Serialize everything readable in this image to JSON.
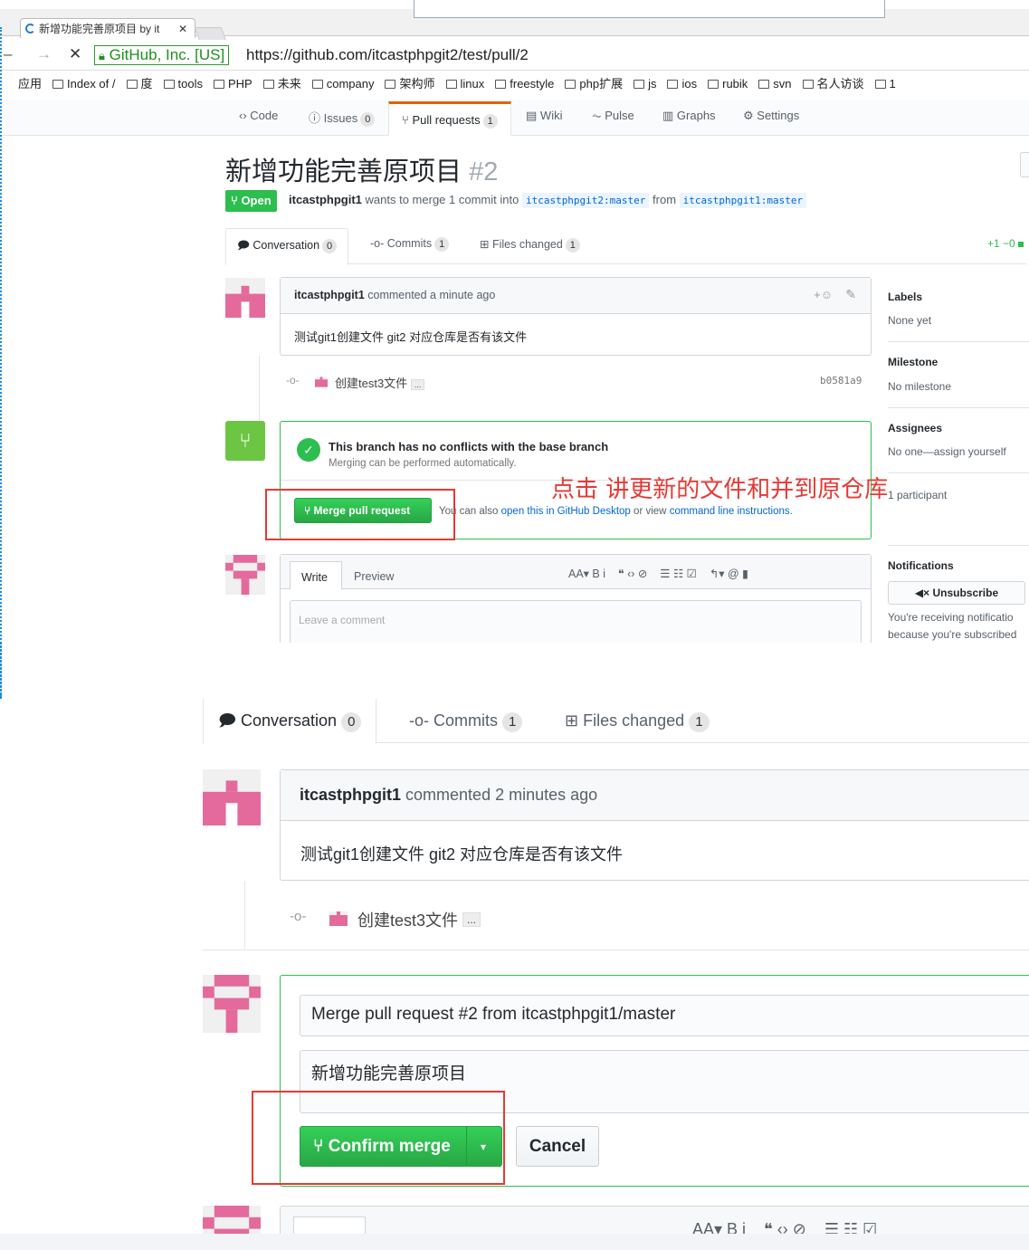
{
  "browser": {
    "tab_title": "新增功能完善原项目 by it",
    "secure_label": "GitHub, Inc. [US]",
    "url": "https://github.com/itcastphpgit2/test/pull/2",
    "bookmarks": [
      "应用",
      "Index of /",
      "度",
      "tools",
      "PHP",
      "未来",
      "company",
      "架构师",
      "linux",
      "freestyle",
      "php扩展",
      "js",
      "ios",
      "rubik",
      "svn",
      "名人访谈",
      "1"
    ]
  },
  "repo_nav": {
    "code": "Code",
    "issues": "Issues",
    "issues_count": "0",
    "pulls": "Pull requests",
    "pulls_count": "1",
    "wiki": "Wiki",
    "pulse": "Pulse",
    "graphs": "Graphs",
    "settings": "Settings"
  },
  "pr": {
    "title": "新增功能完善原项目",
    "number": "#2",
    "state": "Open",
    "author": "itcastphpgit1",
    "merge_text": "wants to merge 1 commit into",
    "base": "itcastphpgit2:master",
    "from_text": "from",
    "head": "itcastphpgit1:master",
    "diffstat": "+1 −0"
  },
  "pr_tabs": {
    "conversation": "Conversation",
    "conversation_count": "0",
    "commits": "Commits",
    "commits_count": "1",
    "files": "Files changed",
    "files_count": "1"
  },
  "top": {
    "comment_author": "itcastphpgit1",
    "comment_time": "commented a minute ago",
    "comment_body": "测试git1创建文件 git2 对应仓库是否有该文件",
    "commit_msg": "创建test3文件",
    "commit_ellipsis": "...",
    "commit_sha": "b0581a9",
    "merge_status_title": "This branch has no conflicts with the base branch",
    "merge_status_sub": "Merging can be performed automatically.",
    "merge_button": "Merge pull request",
    "merge_hint_1": "You can also",
    "merge_hint_link1": "open this in GitHub Desktop",
    "merge_hint_2": "or view",
    "merge_hint_link2": "command line instructions.",
    "annotation": "点击   讲更新的文件和并到原仓库",
    "write_tab": "Write",
    "preview_tab": "Preview",
    "comment_placeholder": "Leave a comment",
    "toolbar": "AA▾ B i    ❝ ‹› ⊘    ☰ ☷ ☑    ↰▾ @ ▮"
  },
  "sidebar": {
    "labels_h": "Labels",
    "labels_v": "None yet",
    "milestone_h": "Milestone",
    "milestone_v": "No milestone",
    "assignees_h": "Assignees",
    "assignees_v": "No one—assign yourself",
    "participants": "1 participant",
    "notifications_h": "Notifications",
    "unsubscribe": "Unsubscribe",
    "notif_text_1": "You're receiving notificatio",
    "notif_text_2": "because you're subscribed"
  },
  "bottom": {
    "comment_author": "itcastphpgit1",
    "comment_time": "commented 2 minutes ago",
    "comment_body": "测试git1创建文件 git2 对应仓库是否有该文件",
    "commit_msg": "创建test3文件",
    "commit_ellipsis": "...",
    "merge_title_value": "Merge pull request #2 from itcastphpgit1/master",
    "merge_body_value": "新增功能完善原项目",
    "confirm_button": "Confirm merge",
    "cancel_button": "Cancel",
    "toolbar": "AA▾ B i    ❝ ‹› ⊘    ☰ ☷ ☑"
  },
  "colors": {
    "green": "#2cbe4e",
    "annotation_red": "#e53935",
    "link_blue": "#0366d6",
    "avatar_pink": "#e46a9c"
  }
}
